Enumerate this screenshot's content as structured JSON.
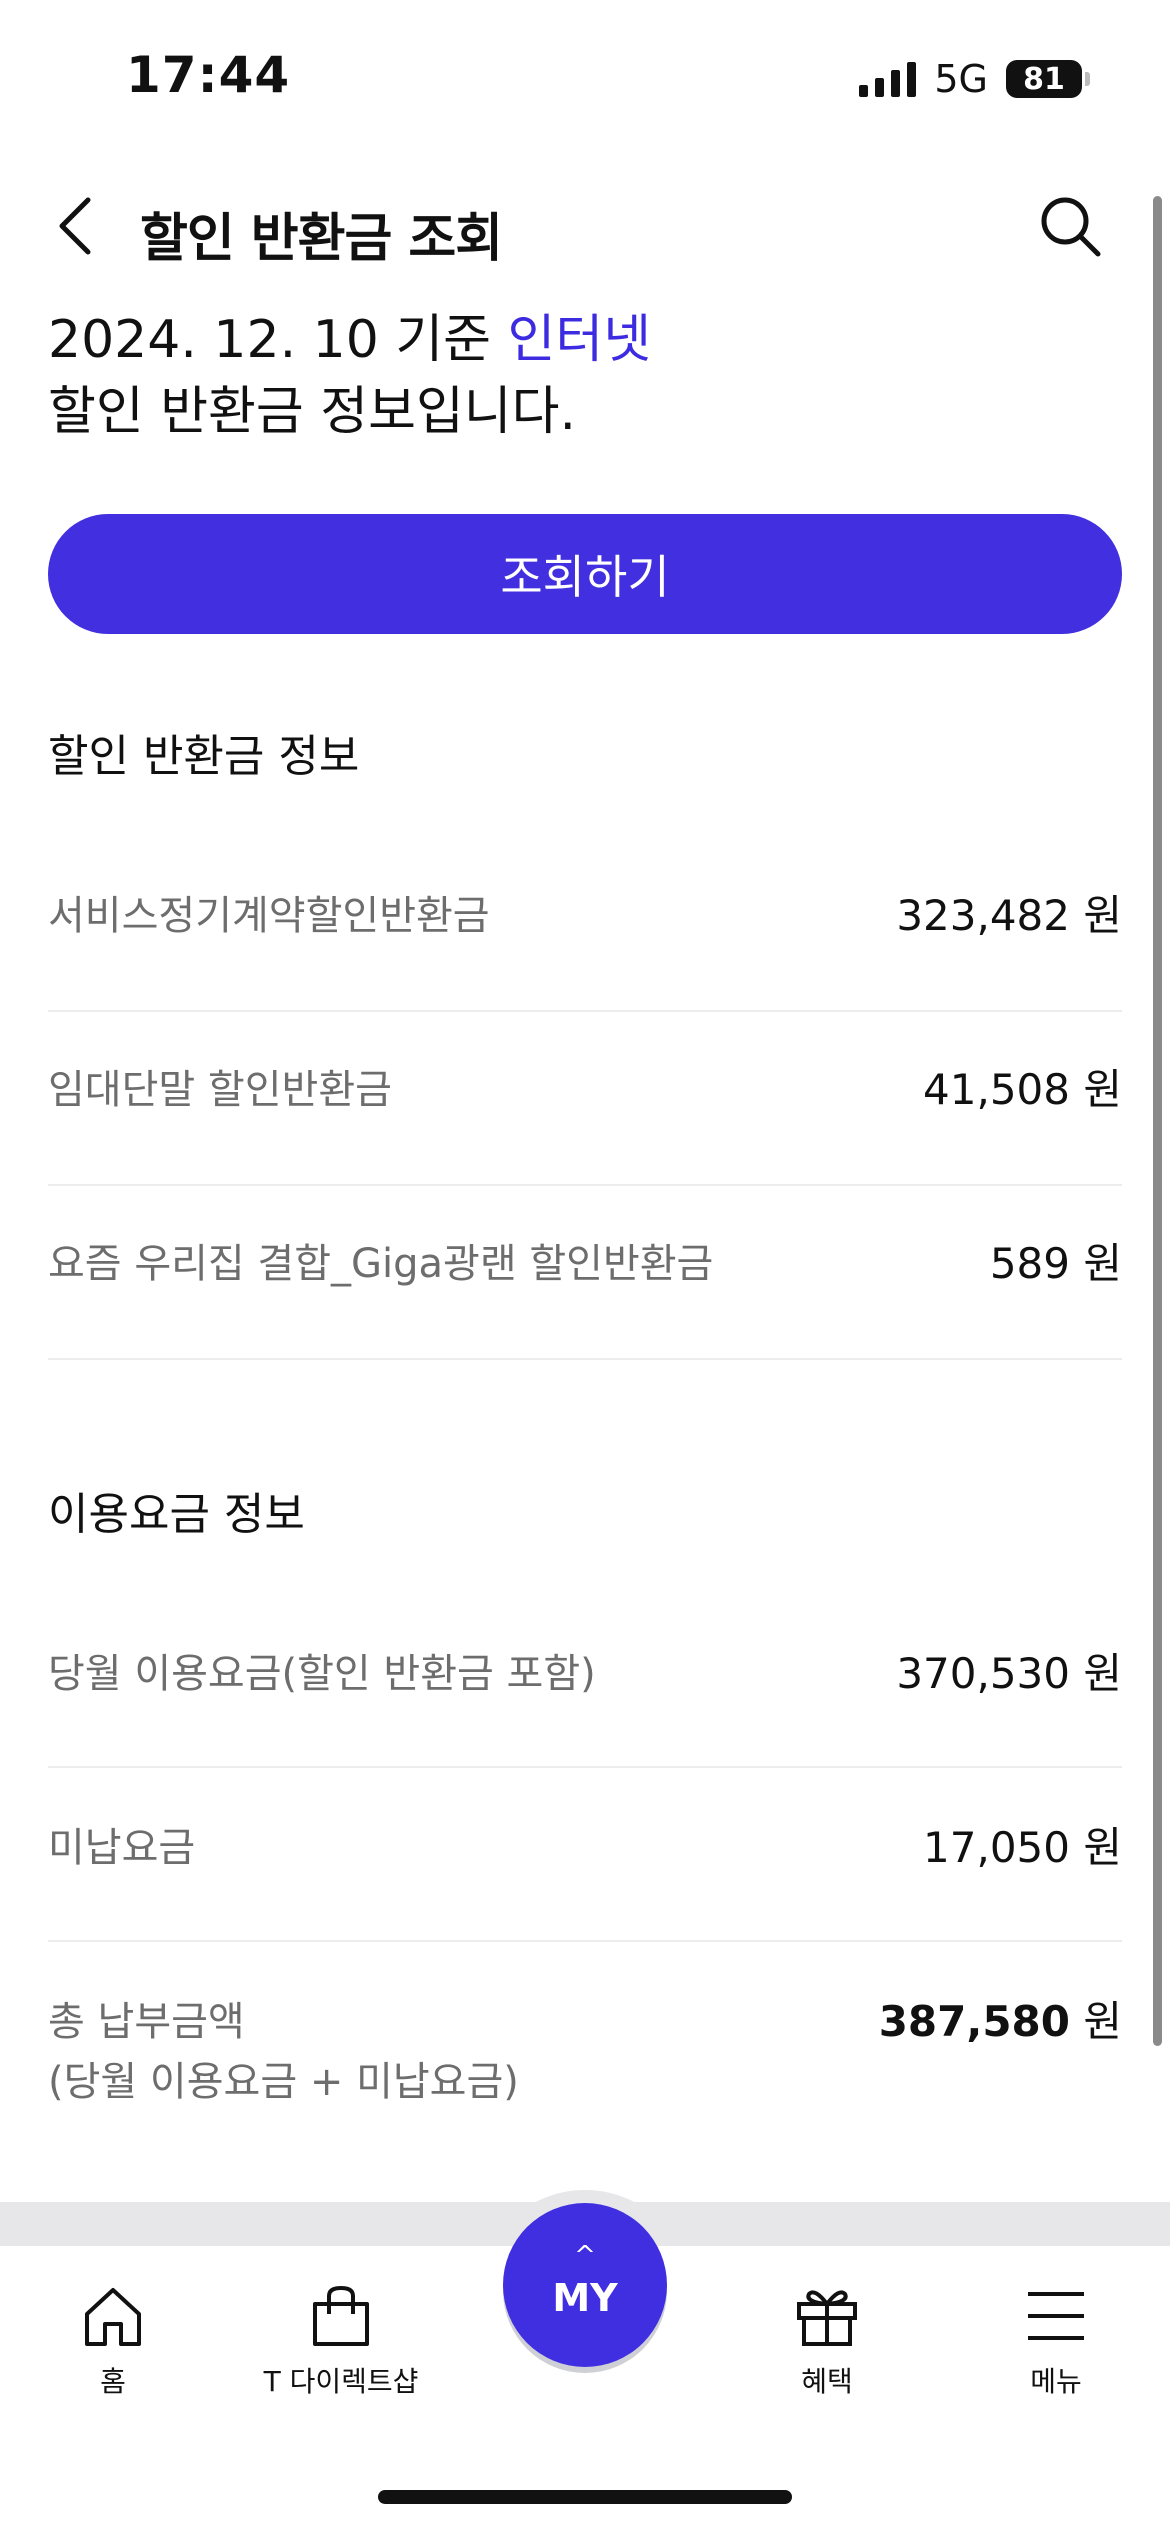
{
  "status_bar": {
    "time": "17:44",
    "network": "5G",
    "battery": "81"
  },
  "header": {
    "title": "할인 반환금 조회"
  },
  "intro": {
    "date_text": "2024. 12. 10 기준 ",
    "service": "인터넷",
    "line2": "할인 반환금 정보입니다."
  },
  "cta": {
    "label": "조회하기"
  },
  "discount_section": {
    "title": "할인 반환금 정보",
    "rows": [
      {
        "label": "서비스정기계약할인반환금",
        "value": "323,482",
        "unit": " 원"
      },
      {
        "label": "임대단말 할인반환금",
        "value": "41,508",
        "unit": " 원"
      },
      {
        "label": "요즘 우리집 결합_Giga광랜 할인반환금",
        "value": "589",
        "unit": " 원"
      }
    ]
  },
  "fee_section": {
    "title": "이용요금 정보",
    "rows": [
      {
        "label": "당월 이용요금(할인 반환금 포함)",
        "value": "370,530",
        "unit": " 원"
      },
      {
        "label": "미납요금",
        "value": "17,050",
        "unit": " 원"
      }
    ],
    "total": {
      "label_line1": "총 납부금액",
      "label_line2": "(당월 이용요금 + 미납요금)",
      "value": "387,580",
      "unit": " 원"
    }
  },
  "bottom_nav": {
    "items": [
      {
        "label": "홈",
        "icon": "home-icon"
      },
      {
        "label": "T 다이렉트샵",
        "icon": "shopping-bag-icon"
      },
      {
        "label": "혜택",
        "icon": "gift-icon"
      },
      {
        "label": "메뉴",
        "icon": "menu-icon"
      }
    ],
    "my_label": "MY",
    "my_caret": "^"
  },
  "colors": {
    "accent": "#4230e0"
  }
}
